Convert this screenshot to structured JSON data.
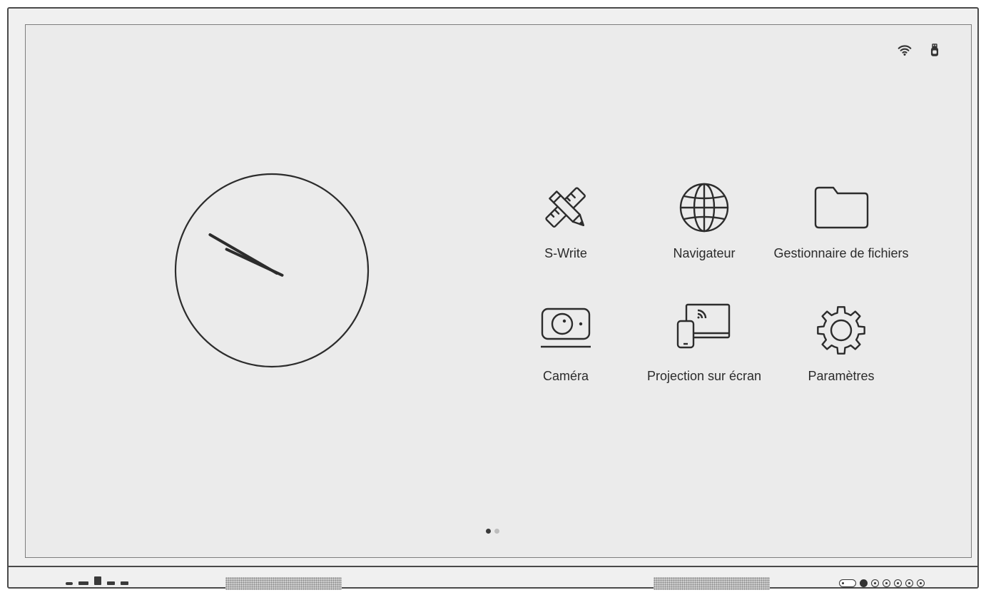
{
  "apps": [
    {
      "label": "S-Write",
      "icon": "pen-ruler-icon"
    },
    {
      "label": "Navigateur",
      "icon": "globe-icon"
    },
    {
      "label": "Gestionnaire de fichiers",
      "icon": "folder-icon"
    },
    {
      "label": "Caméra",
      "icon": "camera-icon"
    },
    {
      "label": "Projection sur écran",
      "icon": "screen-cast-icon"
    },
    {
      "label": "Paramètres",
      "icon": "gear-icon"
    }
  ],
  "status": {
    "icons": [
      "wifi-icon",
      "usb-icon"
    ]
  },
  "clock": {
    "hour": 9,
    "minute": 50
  },
  "pager": {
    "current_page": 1,
    "total_pages": 2
  },
  "colors": {
    "screen_bg": "#ebebeb",
    "ink": "#2c2c2c",
    "bezel": "#4a4a4a"
  }
}
